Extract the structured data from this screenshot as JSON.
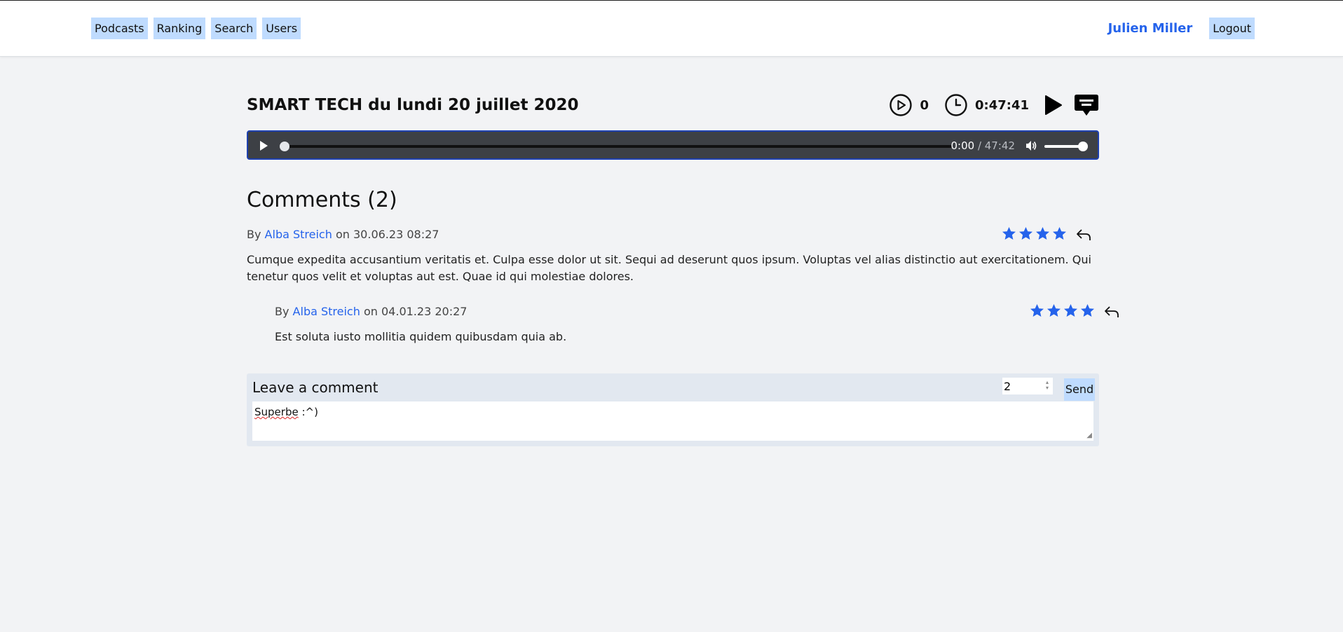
{
  "nav": {
    "items": [
      {
        "label": "Podcasts"
      },
      {
        "label": "Ranking"
      },
      {
        "label": "Search"
      },
      {
        "label": "Users"
      }
    ],
    "user_name": "Julien Miller",
    "logout_label": "Logout"
  },
  "episode": {
    "title": "SMART TECH du lundi 20 juillet 2020",
    "play_count": "0",
    "duration": "0:47:41"
  },
  "player": {
    "current_time": "0:00",
    "separator": " / ",
    "total_time": "47:42",
    "progress": 0,
    "volume": 1
  },
  "comments": {
    "title": "Comments (2)",
    "items": [
      {
        "by": "By",
        "author": "Alba Streich",
        "on": "on",
        "date": "30.06.23 08:27",
        "rating": 4,
        "text": "Cumque expedita accusantium veritatis et. Culpa esse dolor ut sit. Sequi ad deserunt quos ipsum. Voluptas vel alias distinctio aut exercitationem. Qui tenetur quos velit et voluptas aut est. Quae id qui molestiae dolores."
      },
      {
        "by": "By",
        "author": "Alba Streich",
        "on": "on",
        "date": "04.01.23 20:27",
        "rating": 4,
        "text": "Est soluta iusto mollitia quidem quibusdam quia ab."
      }
    ]
  },
  "leave_comment": {
    "label": "Leave a comment",
    "rating_value": "2",
    "send_label": "Send",
    "text_word1": "Superbe",
    "text_rest": " :^)"
  },
  "colors": {
    "accent": "#2563eb",
    "nav_button_bg": "#bfdbfe",
    "page_bg": "#f2f3f5"
  }
}
